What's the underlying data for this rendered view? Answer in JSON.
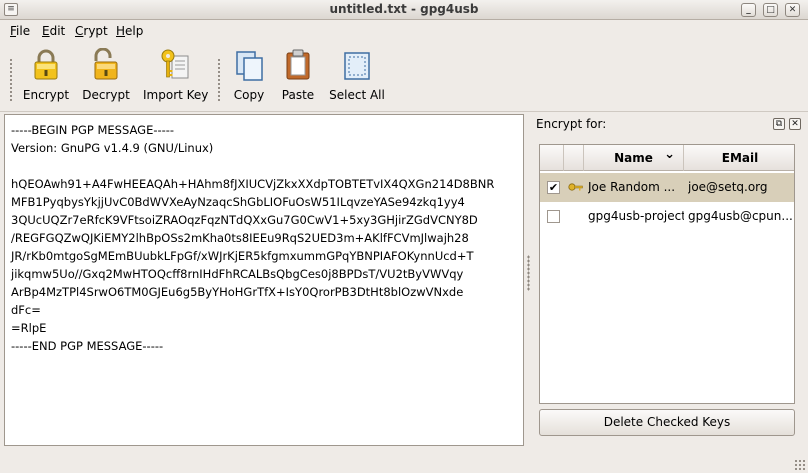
{
  "window": {
    "title": "untitled.txt - gpg4usb",
    "menu_glyph": "≡",
    "minimize_glyph": "_",
    "maximize_glyph": "□",
    "close_glyph": "✕"
  },
  "menu": {
    "file": {
      "accel": "F",
      "rest": "ile"
    },
    "edit": {
      "accel": "E",
      "rest": "dit"
    },
    "crypt": {
      "accel": "C",
      "rest": "rypt"
    },
    "help": {
      "accel": "H",
      "rest": "elp"
    }
  },
  "toolbar": {
    "encrypt": {
      "label": "Encrypt",
      "icon": "lock-closed-icon"
    },
    "decrypt": {
      "label": "Decrypt",
      "icon": "lock-open-icon"
    },
    "import_key": {
      "label": "Import Key",
      "icon": "key-import-icon"
    },
    "copy": {
      "label": "Copy",
      "icon": "copy-icon"
    },
    "paste": {
      "label": "Paste",
      "icon": "paste-icon"
    },
    "select_all": {
      "label": "Select All",
      "icon": "select-all-icon"
    }
  },
  "editor": {
    "text": "-----BEGIN PGP MESSAGE-----\nVersion: GnuPG v1.4.9 (GNU/Linux)\n\nhQEOAwh91+A4FwHEEAQAh+HAhm8fJXIUCVjZkxXXdpTOBTETvIX4QXGn214D8BNR\nMFB1PyqbysYkjjUvC0BdWVXeAyNzaqcShGbLIOFuOsW51ILqvzeYASe94zkq1yy4\n3QUcUQZr7eRfcK9VFtsoiZRAOqzFqzNTdQXxGu7G0CwV1+5xy3GHjirZGdVCNY8D\n/REGFGQZwQJKiEMY2lhBpOSs2mKha0ts8IEEu9RqS2UED3m+AKlfFCVmJlwajh28\nJR/rKb0mtgoSgMEmBUubkLFpGf/xWJrKjER5kfgmxummGPqYBNPIAFOKynnUcd+T\njikqmw5Uo//Gxq2MwHTOQcff8rnIHdFhRCALBsQbgCes0j8BPDsT/VU2tByVWVqy\nArBp4MzTPl4SrwO6TM0GJEu6g5ByYHoHGrTfX+IsY0QrorPB3DtHt8blOzwVNxde\ndFc=\n=RlpE\n-----END PGP MESSAGE-----"
  },
  "keys_panel": {
    "title": "Encrypt for:",
    "float_glyph": "⧉",
    "close_glyph": "✕",
    "columns": {
      "name": "Name",
      "email": "EMail"
    },
    "sort_glyph": "⌄",
    "rows": [
      {
        "name": "Joe Random ...",
        "email": "joe@setq.org",
        "checked": "✔",
        "icon": "keypair-icon"
      },
      {
        "name": "gpg4usb-project",
        "email": "gpg4usb@cpun...",
        "checked": "",
        "icon": ""
      }
    ],
    "delete_label": "Delete Checked Keys"
  }
}
